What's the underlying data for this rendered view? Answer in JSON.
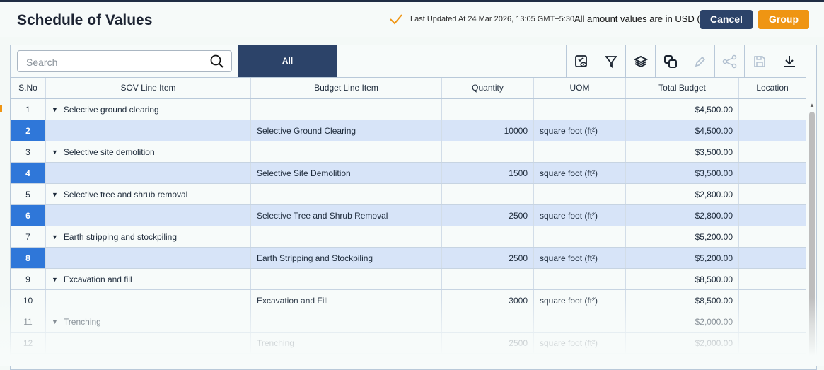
{
  "header": {
    "title": "Schedule of Values",
    "last_updated": "Last Updated At 24 Mar 2026, 13:05 GMT+5:30",
    "currency_note": "All amount values are in USD ($)",
    "cancel_label": "Cancel",
    "group_label": "Group"
  },
  "toolbar": {
    "search_placeholder": "Search",
    "tab_all": "All",
    "icons": [
      "view-settings-icon",
      "filter-icon",
      "layers-icon",
      "copy-icon",
      "edit-icon",
      "share-icon",
      "save-icon",
      "download-icon"
    ]
  },
  "table": {
    "columns": [
      "S.No",
      "SOV Line Item",
      "Budget Line Item",
      "Quantity",
      "UOM",
      "Total Budget",
      "Location"
    ],
    "rows": [
      {
        "sno": "1",
        "sov": "Selective ground clearing",
        "budget": "",
        "qty": "",
        "uom": "",
        "total": "$4,500.00",
        "type": "parent"
      },
      {
        "sno": "2",
        "sov": "",
        "budget": "Selective Ground Clearing",
        "qty": "10000",
        "uom": "square foot (ft²)",
        "total": "$4,500.00",
        "type": "child"
      },
      {
        "sno": "3",
        "sov": "Selective site demolition",
        "budget": "",
        "qty": "",
        "uom": "",
        "total": "$3,500.00",
        "type": "parent"
      },
      {
        "sno": "4",
        "sov": "",
        "budget": "Selective Site Demolition",
        "qty": "1500",
        "uom": "square foot (ft²)",
        "total": "$3,500.00",
        "type": "child"
      },
      {
        "sno": "5",
        "sov": "Selective tree and shrub removal",
        "budget": "",
        "qty": "",
        "uom": "",
        "total": "$2,800.00",
        "type": "parent"
      },
      {
        "sno": "6",
        "sov": "",
        "budget": "Selective Tree and Shrub Removal",
        "qty": "2500",
        "uom": "square foot (ft²)",
        "total": "$2,800.00",
        "type": "child"
      },
      {
        "sno": "7",
        "sov": "Earth stripping and stockpiling",
        "budget": "",
        "qty": "",
        "uom": "",
        "total": "$5,200.00",
        "type": "parent"
      },
      {
        "sno": "8",
        "sov": "",
        "budget": "Earth Stripping and Stockpiling",
        "qty": "2500",
        "uom": "square foot (ft²)",
        "total": "$5,200.00",
        "type": "child"
      },
      {
        "sno": "9",
        "sov": "Excavation and fill",
        "budget": "",
        "qty": "",
        "uom": "",
        "total": "$8,500.00",
        "type": "parent"
      },
      {
        "sno": "10",
        "sov": "",
        "budget": "Excavation and Fill",
        "qty": "3000",
        "uom": "square foot (ft²)",
        "total": "$8,500.00",
        "type": "plain"
      },
      {
        "sno": "11",
        "sov": "Trenching",
        "budget": "",
        "qty": "",
        "uom": "",
        "total": "$2,000.00",
        "type": "parent"
      },
      {
        "sno": "12",
        "sov": "",
        "budget": "Trenching",
        "qty": "2500",
        "uom": "square foot (ft²)",
        "total": "$2,000.00",
        "type": "plain"
      }
    ]
  }
}
